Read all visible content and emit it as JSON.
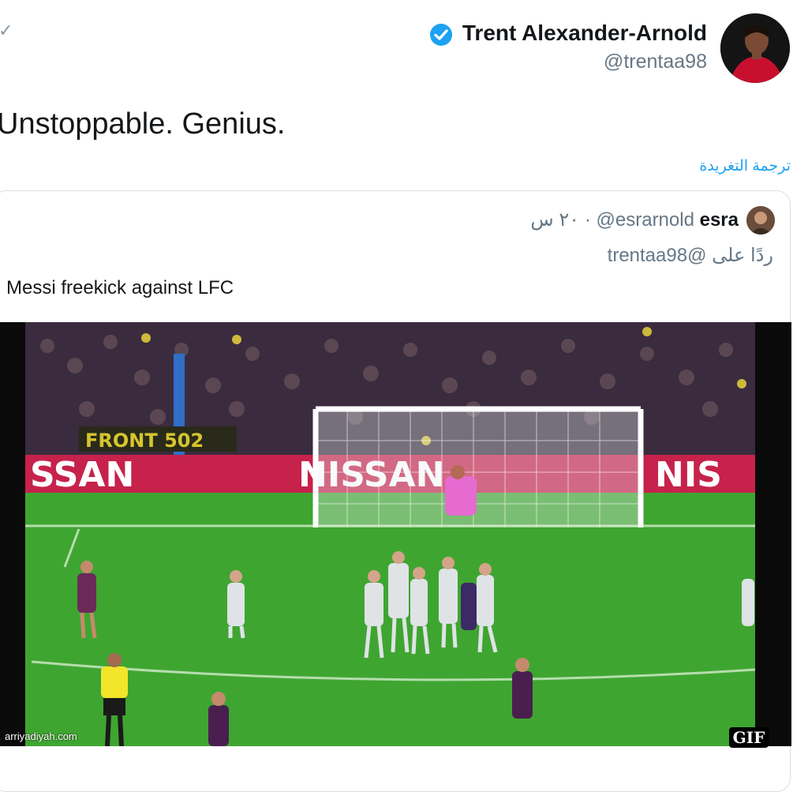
{
  "tweet": {
    "author_name": "Trent Alexander-Arnold",
    "author_handle": "@trentaa98",
    "text": "Unstoppable. Genius.",
    "translate_label": "ترجمة التغريدة"
  },
  "quoted": {
    "name": "esra",
    "handle": "@esrarnold",
    "time": "· ٢٠ س",
    "reply_to": "ردًا على @trentaa98",
    "text": "Messi freekick against LFC"
  },
  "media": {
    "badge": "GIF",
    "ad_boards": [
      "SSAN",
      "NISSAN",
      "NIS"
    ]
  },
  "watermark": "arriyadiyah.com",
  "colors": {
    "link": "#1da1f2",
    "verified": "#1da1f2",
    "secondary_text": "#657786",
    "pitch": "#3fa531",
    "ad_board": "#c6224b"
  }
}
